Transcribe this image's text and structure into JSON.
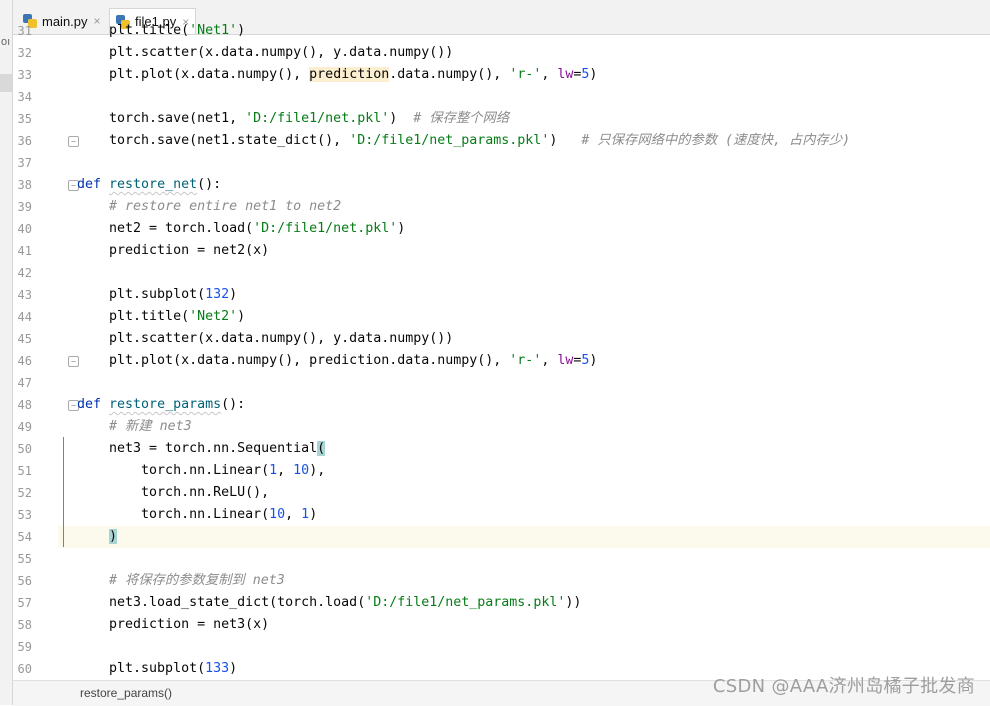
{
  "left_strip": {
    "text": "ıoı"
  },
  "tabs": [
    {
      "label": "main.py",
      "close": "×",
      "active": false
    },
    {
      "label": "file1.py",
      "close": "×",
      "active": true
    }
  ],
  "code": {
    "lines": [
      {
        "n": "31",
        "segments": [
          {
            "t": "    plt.title(",
            "c": ""
          },
          {
            "t": "'Net1'",
            "c": "str"
          },
          {
            "t": ")",
            "c": ""
          }
        ]
      },
      {
        "n": "32",
        "segments": [
          {
            "t": "    plt.scatter(x.data.numpy(), y.data.numpy())",
            "c": ""
          }
        ]
      },
      {
        "n": "33",
        "segments": [
          {
            "t": "    plt.plot(x.data.numpy(), ",
            "c": ""
          },
          {
            "t": "prediction",
            "c": "hl-word"
          },
          {
            "t": ".data.numpy(), ",
            "c": ""
          },
          {
            "t": "'r-'",
            "c": "str"
          },
          {
            "t": ", ",
            "c": ""
          },
          {
            "t": "lw",
            "c": "param"
          },
          {
            "t": "=",
            "c": ""
          },
          {
            "t": "5",
            "c": "num"
          },
          {
            "t": ")",
            "c": ""
          }
        ]
      },
      {
        "n": "34",
        "segments": []
      },
      {
        "n": "35",
        "segments": [
          {
            "t": "    torch.save(net1, ",
            "c": ""
          },
          {
            "t": "'D:/file1/net.pkl'",
            "c": "str"
          },
          {
            "t": ")  ",
            "c": ""
          },
          {
            "t": "# 保存整个网络",
            "c": "cmt"
          }
        ]
      },
      {
        "n": "36",
        "segments": [
          {
            "t": "    torch.save(net1.state_dict(), ",
            "c": ""
          },
          {
            "t": "'D:/file1/net_params.pkl'",
            "c": "str"
          },
          {
            "t": ")   ",
            "c": ""
          },
          {
            "t": "# 只保存网络中的参数 (速度快, 占内存少)",
            "c": "cmt"
          }
        ]
      },
      {
        "n": "37",
        "segments": []
      },
      {
        "n": "38",
        "segments": [
          {
            "t": "def ",
            "c": "kw"
          },
          {
            "t": "restore_net",
            "c": "fn squig"
          },
          {
            "t": "():",
            "c": ""
          }
        ]
      },
      {
        "n": "39",
        "segments": [
          {
            "t": "    ",
            "c": ""
          },
          {
            "t": "# restore entire net1 to net2",
            "c": "cmt"
          }
        ]
      },
      {
        "n": "40",
        "segments": [
          {
            "t": "    net2 = torch.load(",
            "c": ""
          },
          {
            "t": "'D:/file1/net.pkl'",
            "c": "str"
          },
          {
            "t": ")",
            "c": ""
          }
        ]
      },
      {
        "n": "41",
        "segments": [
          {
            "t": "    prediction = net2(x)",
            "c": ""
          }
        ]
      },
      {
        "n": "42",
        "segments": []
      },
      {
        "n": "43",
        "segments": [
          {
            "t": "    plt.subplot(",
            "c": ""
          },
          {
            "t": "132",
            "c": "num"
          },
          {
            "t": ")",
            "c": ""
          }
        ]
      },
      {
        "n": "44",
        "segments": [
          {
            "t": "    plt.title(",
            "c": ""
          },
          {
            "t": "'Net2'",
            "c": "str"
          },
          {
            "t": ")",
            "c": ""
          }
        ]
      },
      {
        "n": "45",
        "segments": [
          {
            "t": "    plt.scatter(x.data.numpy(), y.data.numpy())",
            "c": ""
          }
        ]
      },
      {
        "n": "46",
        "segments": [
          {
            "t": "    plt.plot(x.data.numpy(), prediction.data.numpy(), ",
            "c": ""
          },
          {
            "t": "'r-'",
            "c": "str"
          },
          {
            "t": ", ",
            "c": ""
          },
          {
            "t": "lw",
            "c": "param"
          },
          {
            "t": "=",
            "c": ""
          },
          {
            "t": "5",
            "c": "num"
          },
          {
            "t": ")",
            "c": ""
          }
        ]
      },
      {
        "n": "47",
        "segments": []
      },
      {
        "n": "48",
        "segments": [
          {
            "t": "def ",
            "c": "kw"
          },
          {
            "t": "restore_params",
            "c": "fn squig"
          },
          {
            "t": "():",
            "c": ""
          }
        ]
      },
      {
        "n": "49",
        "segments": [
          {
            "t": "    ",
            "c": ""
          },
          {
            "t": "# 新建 net3",
            "c": "cmt"
          }
        ]
      },
      {
        "n": "50",
        "segments": [
          {
            "t": "    net3 = torch.nn.Sequential",
            "c": ""
          },
          {
            "t": "(",
            "c": "brace"
          }
        ]
      },
      {
        "n": "51",
        "segments": [
          {
            "t": "        torch.nn.Linear(",
            "c": ""
          },
          {
            "t": "1",
            "c": "num"
          },
          {
            "t": ", ",
            "c": ""
          },
          {
            "t": "10",
            "c": "num"
          },
          {
            "t": "),",
            "c": ""
          }
        ]
      },
      {
        "n": "52",
        "segments": [
          {
            "t": "        torch.nn.ReLU(),",
            "c": ""
          }
        ]
      },
      {
        "n": "53",
        "segments": [
          {
            "t": "        torch.nn.Linear(",
            "c": ""
          },
          {
            "t": "10",
            "c": "num"
          },
          {
            "t": ", ",
            "c": ""
          },
          {
            "t": "1",
            "c": "num"
          },
          {
            "t": ")",
            "c": ""
          }
        ]
      },
      {
        "n": "54",
        "segments": [
          {
            "t": "    ",
            "c": ""
          },
          {
            "t": ")",
            "c": "brace"
          }
        ],
        "current": true
      },
      {
        "n": "55",
        "segments": []
      },
      {
        "n": "56",
        "segments": [
          {
            "t": "    ",
            "c": ""
          },
          {
            "t": "# 将保存的参数复制到 net3",
            "c": "cmt"
          }
        ]
      },
      {
        "n": "57",
        "segments": [
          {
            "t": "    net3.load_state_dict(torch.load(",
            "c": ""
          },
          {
            "t": "'D:/file1/net_params.pkl'",
            "c": "str"
          },
          {
            "t": "))",
            "c": ""
          }
        ]
      },
      {
        "n": "58",
        "segments": [
          {
            "t": "    prediction = net3(x)",
            "c": ""
          }
        ]
      },
      {
        "n": "59",
        "segments": []
      },
      {
        "n": "60",
        "segments": [
          {
            "t": "    plt.subplot(",
            "c": ""
          },
          {
            "t": "133",
            "c": "num"
          },
          {
            "t": ")",
            "c": ""
          }
        ]
      }
    ]
  },
  "status": {
    "breadcrumb": "restore_params()"
  },
  "watermark": "CSDN @AAA济州岛橘子批发商",
  "colors": {
    "keyword": "#0033b3",
    "string": "#067d17",
    "number": "#1750eb",
    "comment": "#8c8c8c",
    "function": "#00627a",
    "current_line": "#fcfaed"
  }
}
